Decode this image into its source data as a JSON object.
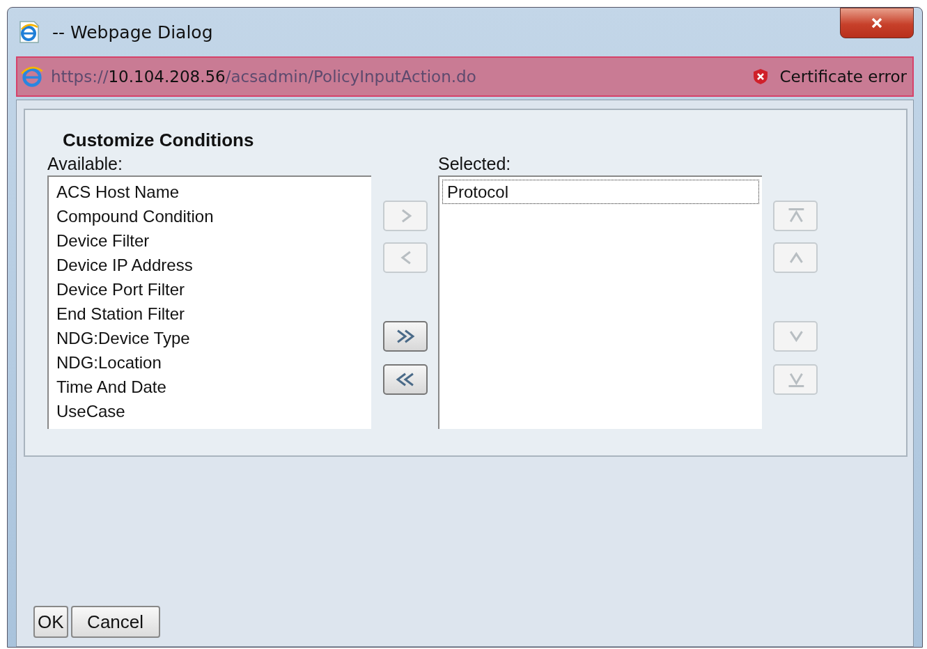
{
  "window": {
    "title": "-- Webpage Dialog"
  },
  "address_bar": {
    "url_prefix": "https://",
    "url_host": "10.104.208.56",
    "url_path": "/acsadmin/PolicyInputAction.do",
    "certificate": "Certificate error"
  },
  "heading": "Customize Conditions",
  "available": {
    "label": "Available:",
    "items": [
      {
        "label": "ACS Host Name",
        "selected": false
      },
      {
        "label": "Compound Condition",
        "selected": false
      },
      {
        "label": "Device Filter",
        "selected": false
      },
      {
        "label": "Device IP Address",
        "selected": false
      },
      {
        "label": "Device Port Filter",
        "selected": false
      },
      {
        "label": "End Station Filter",
        "selected": false
      },
      {
        "label": "NDG:Device Type",
        "selected": false
      },
      {
        "label": "NDG:Location",
        "selected": false
      },
      {
        "label": "Time And Date",
        "selected": false
      },
      {
        "label": "UseCase",
        "selected": false
      }
    ]
  },
  "move_buttons": [
    {
      "kind": "add",
      "disabled": true
    },
    {
      "kind": "remove",
      "disabled": true
    },
    {
      "kind": "add-all",
      "disabled": false
    },
    {
      "kind": "remove-all",
      "disabled": false
    }
  ],
  "selected": {
    "label": "Selected:",
    "items": [
      {
        "label": "Protocol",
        "selected": true
      }
    ]
  },
  "order_buttons": [
    {
      "kind": "top",
      "disabled": true
    },
    {
      "kind": "up",
      "disabled": true
    },
    {
      "kind": "down",
      "disabled": true
    },
    {
      "kind": "bottom",
      "disabled": true
    }
  ],
  "buttons": [
    "OK",
    "Cancel"
  ]
}
